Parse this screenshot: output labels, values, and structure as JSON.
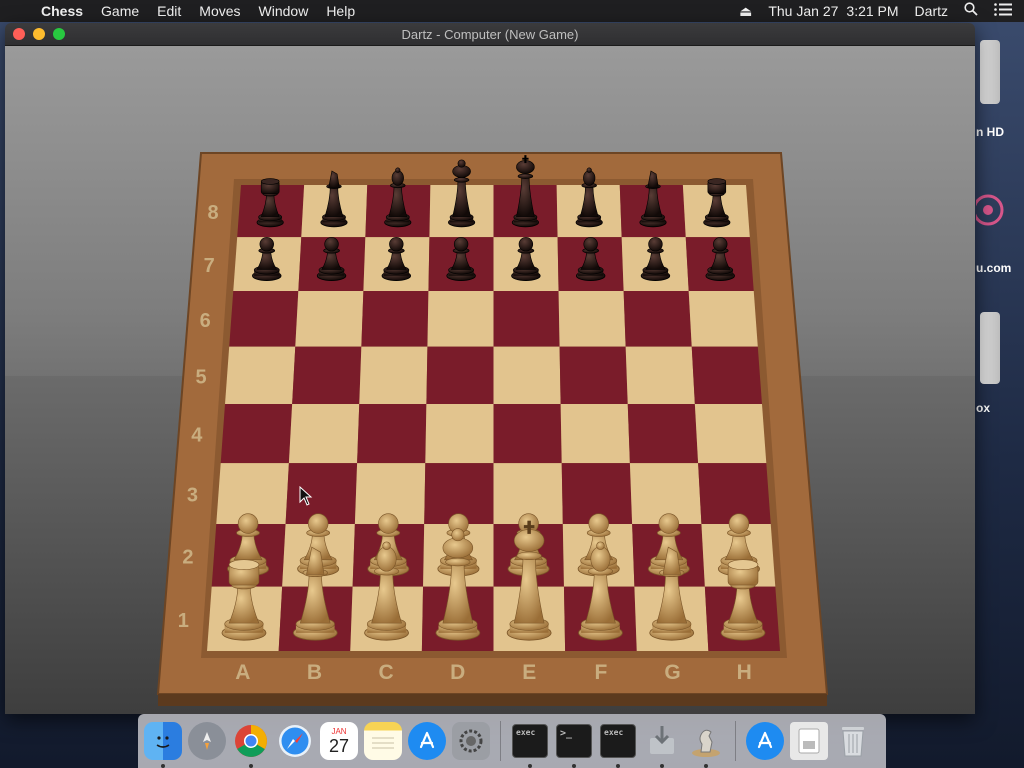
{
  "menubar": {
    "apple": "",
    "app": "Chess",
    "items": [
      "Game",
      "Edit",
      "Moves",
      "Window",
      "Help"
    ],
    "date": "Thu Jan 27",
    "time": "3:21 PM",
    "user": "Dartz"
  },
  "desktop": {
    "labels": [
      "n HD",
      "u.com",
      "ox"
    ]
  },
  "window": {
    "title": "Dartz - Computer   (New Game)"
  },
  "board": {
    "files": [
      "A",
      "B",
      "C",
      "D",
      "E",
      "F",
      "G",
      "H"
    ],
    "ranks": [
      "1",
      "2",
      "3",
      "4",
      "5",
      "6",
      "7",
      "8"
    ],
    "light_color": "#e2c48e",
    "dark_color": "#7a1c2a",
    "frame_color": "#a26a3c",
    "white_piece_color": "#c49a5e",
    "black_piece_color": "#2a1a18",
    "setup": {
      "8": [
        "rook",
        "knight",
        "bishop",
        "queen",
        "king",
        "bishop",
        "knight",
        "rook"
      ],
      "7": [
        "pawn",
        "pawn",
        "pawn",
        "pawn",
        "pawn",
        "pawn",
        "pawn",
        "pawn"
      ],
      "2": [
        "pawn",
        "pawn",
        "pawn",
        "pawn",
        "pawn",
        "pawn",
        "pawn",
        "pawn"
      ],
      "1": [
        "rook",
        "knight",
        "bishop",
        "queen",
        "king",
        "bishop",
        "knight",
        "rook"
      ]
    }
  },
  "dock": {
    "calendar_month": "JAN",
    "calendar_day": "27",
    "terminal_labels": [
      "exec",
      ">_",
      "exec"
    ]
  }
}
